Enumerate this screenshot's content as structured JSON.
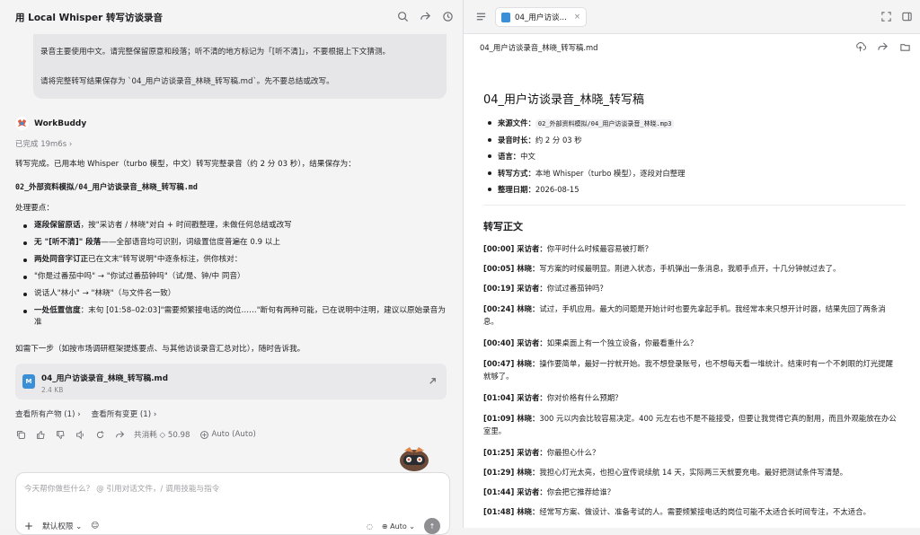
{
  "left": {
    "title": "用 Local Whisper 转写访谈录音",
    "user_message": {
      "line1": "录音主要使用中文。请完整保留原意和段落；听不清的地方标记为「[听不清]」，不要根据上下文猜测。",
      "line2": "请将完整转写结果保存为 `04_用户访谈录音_林晓_转写稿.md`。先不要总结或改写。"
    },
    "bot": {
      "name": "WorkBuddy",
      "status": "已完成 19m6s",
      "intro": "转写完成。已用本地 Whisper（turbo 模型，中文）转写完整录音（约 2 分 03 秒），结果保存为：",
      "path": "02_外部资料模拟/04_用户访谈录音_林晓_转写稿.md",
      "points_title": "处理要点：",
      "bullets": [
        {
          "bold": "逐段保留原话",
          "text": "，按\"采访者 / 林晓\"对白 + 时间戳整理，未做任何总结或改写"
        },
        {
          "bold": "无 \"[听不清]\" 段落",
          "text": "——全部语音均可识别，词级置信度普遍在 0.9 以上"
        },
        {
          "bold": "两处同音字订正",
          "text": "已在文末\"转写说明\"中逐条标注，供你核对："
        },
        {
          "bold": "",
          "text": "\"你是过番茄中吗\" → \"你试过番茄钟吗\"（试/是、钟/中 同音）"
        },
        {
          "bold": "",
          "text": "说话人\"林小\" → \"林晓\"（与文件名一致）"
        },
        {
          "bold": "一处低置信度",
          "text": "：末句 [01:58–02:03]\"需要频繁接电话的岗位……\"断句有两种可能，已在说明中注明，建议以原始录音为准"
        }
      ],
      "next_step": "如需下一步（如按市场调研框架提炼要点、与其他访谈录音汇总对比），随时告诉我。"
    },
    "file_card": {
      "name": "04_用户访谈录音_林晓_转写稿.md",
      "size": "2.4 KB",
      "icon_letter": "M"
    },
    "links": {
      "artifacts": "查看所有产物 (1)",
      "changes": "查看所有变更 (1)"
    },
    "actions": {
      "cost": "共消耗 ◇ 50.98",
      "mode": "Auto (Auto)"
    },
    "composer": {
      "placeholder": "今天帮你做些什么？ @ 引用对话文件，/ 调用技能与指令",
      "mode": "默认权限",
      "model": "Auto"
    }
  },
  "right": {
    "tab_label": "04_用户访谈...",
    "file_path": "04_用户访谈录音_林晓_转写稿.md",
    "doc": {
      "title": "04_用户访谈录音_林晓_转写稿",
      "meta": [
        {
          "label": "来源文件",
          "value": "02_外部资料模拟/04_用户访谈录音_林晓.mp3",
          "code": true
        },
        {
          "label": "录音时长",
          "value": "约 2 分 03 秒",
          "code": false
        },
        {
          "label": "语言",
          "value": "中文",
          "code": false
        },
        {
          "label": "转写方式",
          "value": "本地 Whisper（turbo 模型），逐段对白整理",
          "code": false
        },
        {
          "label": "整理日期",
          "value": "2026-08-15",
          "code": false
        }
      ],
      "section_title": "转写正文",
      "lines": [
        {
          "ts": "[00:00]",
          "speaker": "采访者",
          "text": "你平时什么时候最容易被打断？"
        },
        {
          "ts": "[00:05]",
          "speaker": "林晓",
          "text": "写方案的时候最明显。刚进入状态，手机弹出一条消息，我顺手点开，十几分钟就过去了。"
        },
        {
          "ts": "[00:19]",
          "speaker": "采访者",
          "text": "你试过番茄钟吗？"
        },
        {
          "ts": "[00:24]",
          "speaker": "林晓",
          "text": "试过，手机应用。最大的问题是开始计时也要先拿起手机。我经常本来只想开计时器，结果先回了两条消息。"
        },
        {
          "ts": "[00:40]",
          "speaker": "采访者",
          "text": "如果桌面上有一个独立设备，你最看重什么？"
        },
        {
          "ts": "[00:47]",
          "speaker": "林晓",
          "text": "操作要简单，最好一拧就开始。我不想登录账号，也不想每天看一堆统计。结束时有一个不刺眼的灯光提醒就够了。"
        },
        {
          "ts": "[01:04]",
          "speaker": "采访者",
          "text": "你对价格有什么预期？"
        },
        {
          "ts": "[01:09]",
          "speaker": "林晓",
          "text": "300 元以内会比较容易决定。400 元左右也不是不能接受，但要让我觉得它真的耐用，而且外观能放在办公室里。"
        },
        {
          "ts": "[01:25]",
          "speaker": "采访者",
          "text": "你最担心什么？"
        },
        {
          "ts": "[01:29]",
          "speaker": "林晓",
          "text": "我担心灯光太亮，也担心宣传说续航 14 天，实际两三天就要充电。最好把测试条件写清楚。"
        },
        {
          "ts": "[01:44]",
          "speaker": "采访者",
          "text": "你会把它推荐给谁？"
        },
        {
          "ts": "[01:48]",
          "speaker": "林晓",
          "text": "经常写方案、做设计、准备考试的人。需要频繁接电话的岗位可能不太适合长时间专注，不太适合。"
        }
      ]
    }
  }
}
